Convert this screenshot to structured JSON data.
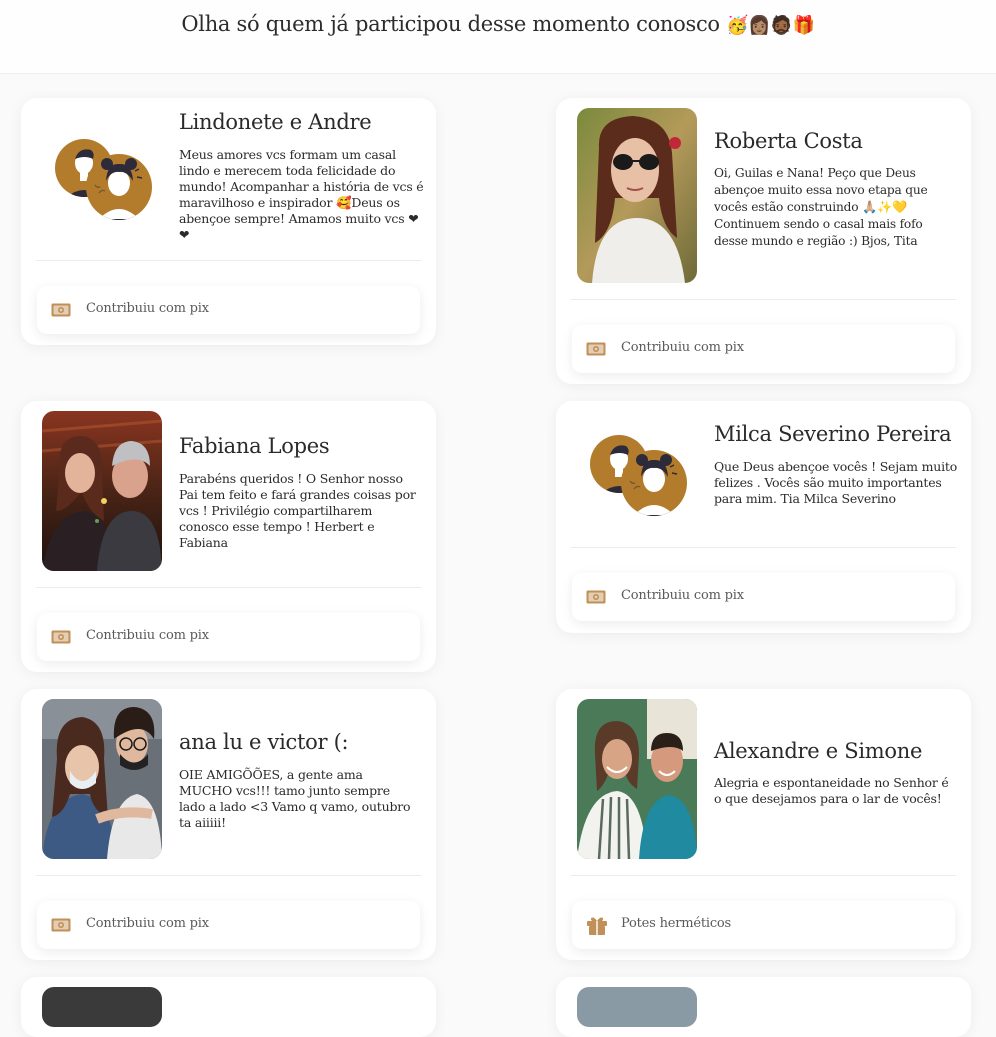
{
  "header": {
    "title": "Olha só quem já participou desse momento conosco",
    "emojis": "🥳👩🏽🧔🏾🎁"
  },
  "colors": {
    "accent": "#b8844a",
    "avatar_bg": "#b27c2c",
    "avatar_dark": "#2d2a3a"
  },
  "cards": [
    {
      "name": "Lindonete e Andre",
      "message": "Meus amores vcs formam um casal lindo e merecem toda felicidade do mundo! Acompanhar a história de vcs é maravilhoso e inspirador 🥰Deus os abençoe sempre! Amamos muito vcs ❤❤",
      "photo": "default-couple-avatar",
      "contribution": "Contribuiu com pix",
      "contribution_icon": "money-bill-icon"
    },
    {
      "name": "Roberta Costa",
      "message": "Oi, Guilas e Nana! Peço que Deus abençoe muito essa novo etapa que vocês estão construindo 🙏🏼✨💛 Continuem sendo o casal mais fofo desse mundo e região :) Bjos, Tita",
      "photo": "user-photo",
      "contribution": "Contribuiu com pix",
      "contribution_icon": "money-bill-icon"
    },
    {
      "name": "Fabiana Lopes",
      "message": "Parabéns queridos ! O Senhor nosso Pai tem feito e fará grandes coisas por vcs ! Privilégio compartilharem conosco esse tempo ! Herbert e Fabiana",
      "photo": "user-photo",
      "contribution": "Contribuiu com pix",
      "contribution_icon": "money-bill-icon"
    },
    {
      "name": "Milca Severino Pereira",
      "message": "Que Deus abençoe vocês ! Sejam muito felizes . Vocês são muito importantes para mim. Tia Milca Severino",
      "photo": "default-couple-avatar",
      "contribution": "Contribuiu com pix",
      "contribution_icon": "money-bill-icon"
    },
    {
      "name": "ana lu e victor (:",
      "message": "OIE AMIGÕÕES, a gente ama MUCHO vcs!!! tamo junto sempre lado a lado <3 Vamo q vamo, outubro ta aiiiii!",
      "photo": "user-photo",
      "contribution": "Contribuiu com pix",
      "contribution_icon": "money-bill-icon"
    },
    {
      "name": "Alexandre e Simone",
      "message": "Alegria e espontaneidade no Senhor é o que desejamos para o lar de vocês!",
      "photo": "user-photo",
      "contribution": "Potes herméticos",
      "contribution_icon": "gift-icon"
    }
  ]
}
